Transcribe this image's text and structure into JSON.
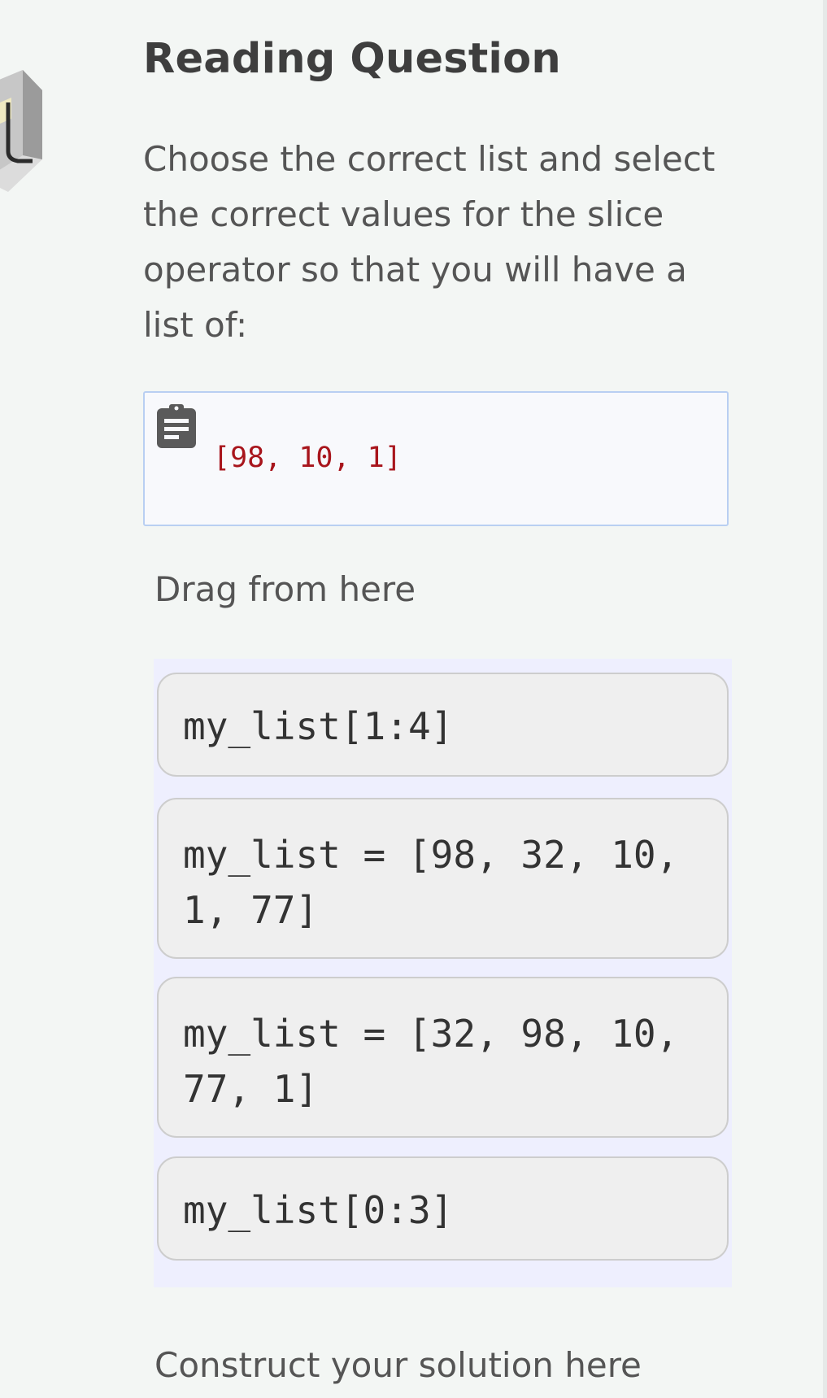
{
  "question": {
    "title": "Reading Question",
    "prompt": "Choose the correct list and select the correct values for the slice operator so that you will have a list of:"
  },
  "target": {
    "code": "[98, 10, 1]"
  },
  "drag_source": {
    "label": "Drag from here",
    "blocks": [
      {
        "line1": "my_list[1:4]",
        "line2": ""
      },
      {
        "line1": "my_list = [98, 32, 10,",
        "line2": "1, 77]"
      },
      {
        "line1": "my_list = [32, 98, 10,",
        "line2": "77, 1]"
      },
      {
        "line1": "my_list[0:3]",
        "line2": ""
      }
    ]
  },
  "solution": {
    "label": "Construct your solution here"
  },
  "colors": {
    "page_bg": "#f3f6f4",
    "code_red": "#a8151c",
    "drag_area_bg": "#eeeffe",
    "block_bg": "#efefef",
    "target_border": "#b9cff2"
  }
}
